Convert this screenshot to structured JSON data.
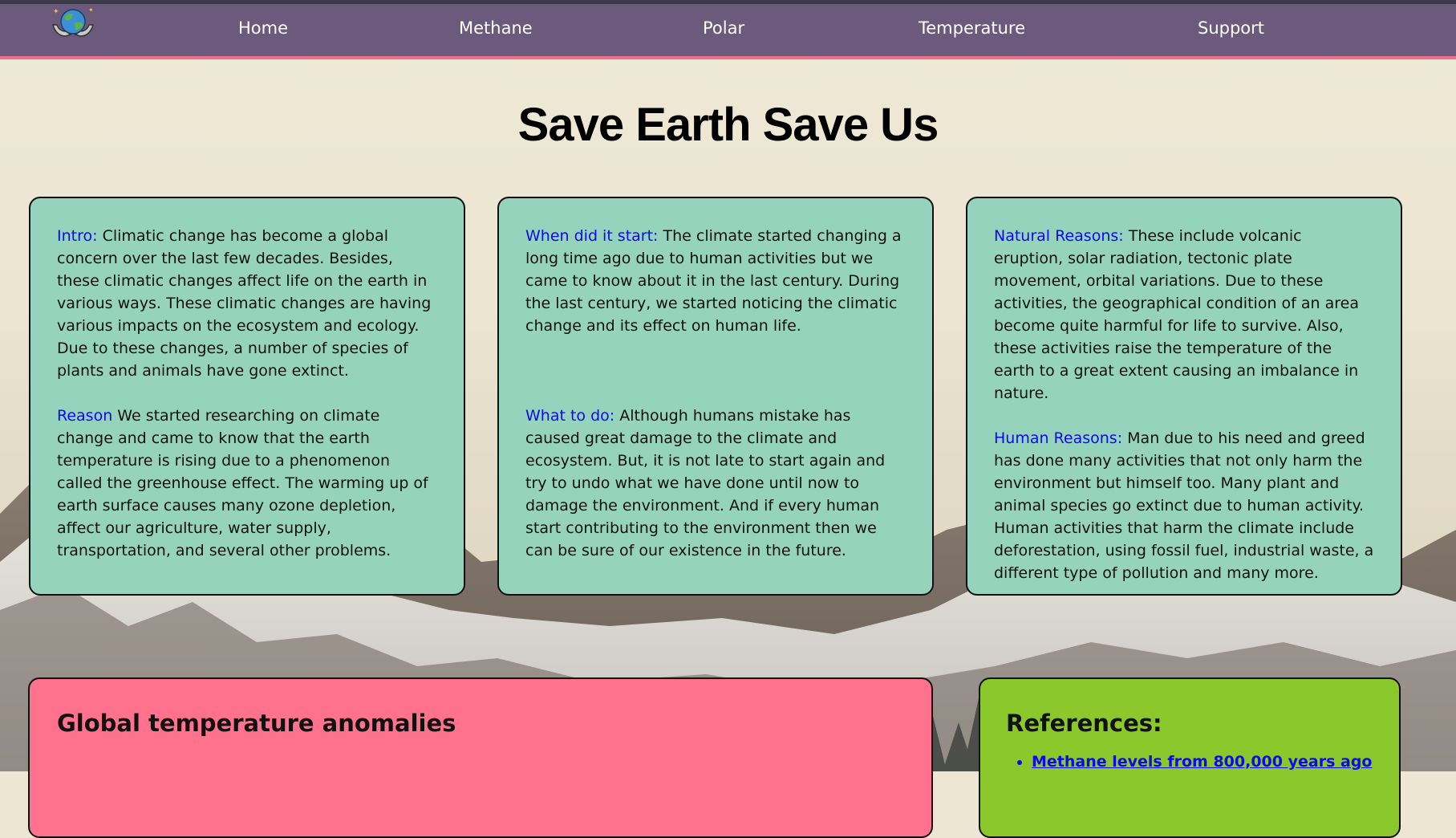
{
  "nav": {
    "logo_icon": "earth-hands-icon",
    "items": [
      "Home",
      "Methane",
      "Polar",
      "Temperature",
      "Support"
    ]
  },
  "page_title": "Save Earth Save Us",
  "cards": [
    {
      "sections": [
        {
          "label": "Intro:",
          "text": "Climatic change has become a global concern over the last few decades. Besides, these climatic changes affect life on the earth in various ways. These climatic changes are having various impacts on the ecosystem and ecology. Due to these changes, a number of species of plants and animals have gone extinct."
        },
        {
          "label": "Reason",
          "text": "We started researching on climate change and came to know that the earth temperature is rising due to a phenomenon called the greenhouse effect. The warming up of earth surface causes many ozone depletion, affect our agriculture, water supply, transportation, and several other problems."
        }
      ]
    },
    {
      "sections": [
        {
          "label": "When did it start:",
          "text": "The climate started changing a long time ago due to human activities but we came to know about it in the last century. During the last century, we started noticing the climatic change and its effect on human life."
        },
        {
          "label": "What to do:",
          "text": "Although humans mistake has caused great damage to the climate and ecosystem. But, it is not late to start again and try to undo what we have done until now to damage the environment. And if every human start contributing to the environment then we can be sure of our existence in the future."
        }
      ]
    },
    {
      "sections": [
        {
          "label": "Natural Reasons:",
          "text": "These include volcanic eruption, solar radiation, tectonic plate movement, orbital variations. Due to these activities, the geographical condition of an area become quite harmful for life to survive. Also, these activities raise the temperature of the earth to a great extent causing an imbalance in nature."
        },
        {
          "label": "Human Reasons:",
          "text": "Man due to his need and greed has done many activities that not only harm the environment but himself too. Many plant and animal species go extinct due to human activity. Human activities that harm the climate include deforestation, using fossil fuel, industrial waste, a different type of pollution and many more."
        }
      ]
    }
  ],
  "temperature": {
    "heading": "Global temperature anomalies"
  },
  "references": {
    "heading": "References:",
    "links": [
      "Methane levels from 800,000 years ago"
    ]
  },
  "colors": {
    "nav_bg": "#6b5a7b",
    "nav_border": "#f06d8b",
    "card_bg": "#95d3bd",
    "label_blue": "#0b0bea",
    "temp_panel_bg": "#fe728d",
    "ref_panel_bg": "#8bc82b"
  }
}
